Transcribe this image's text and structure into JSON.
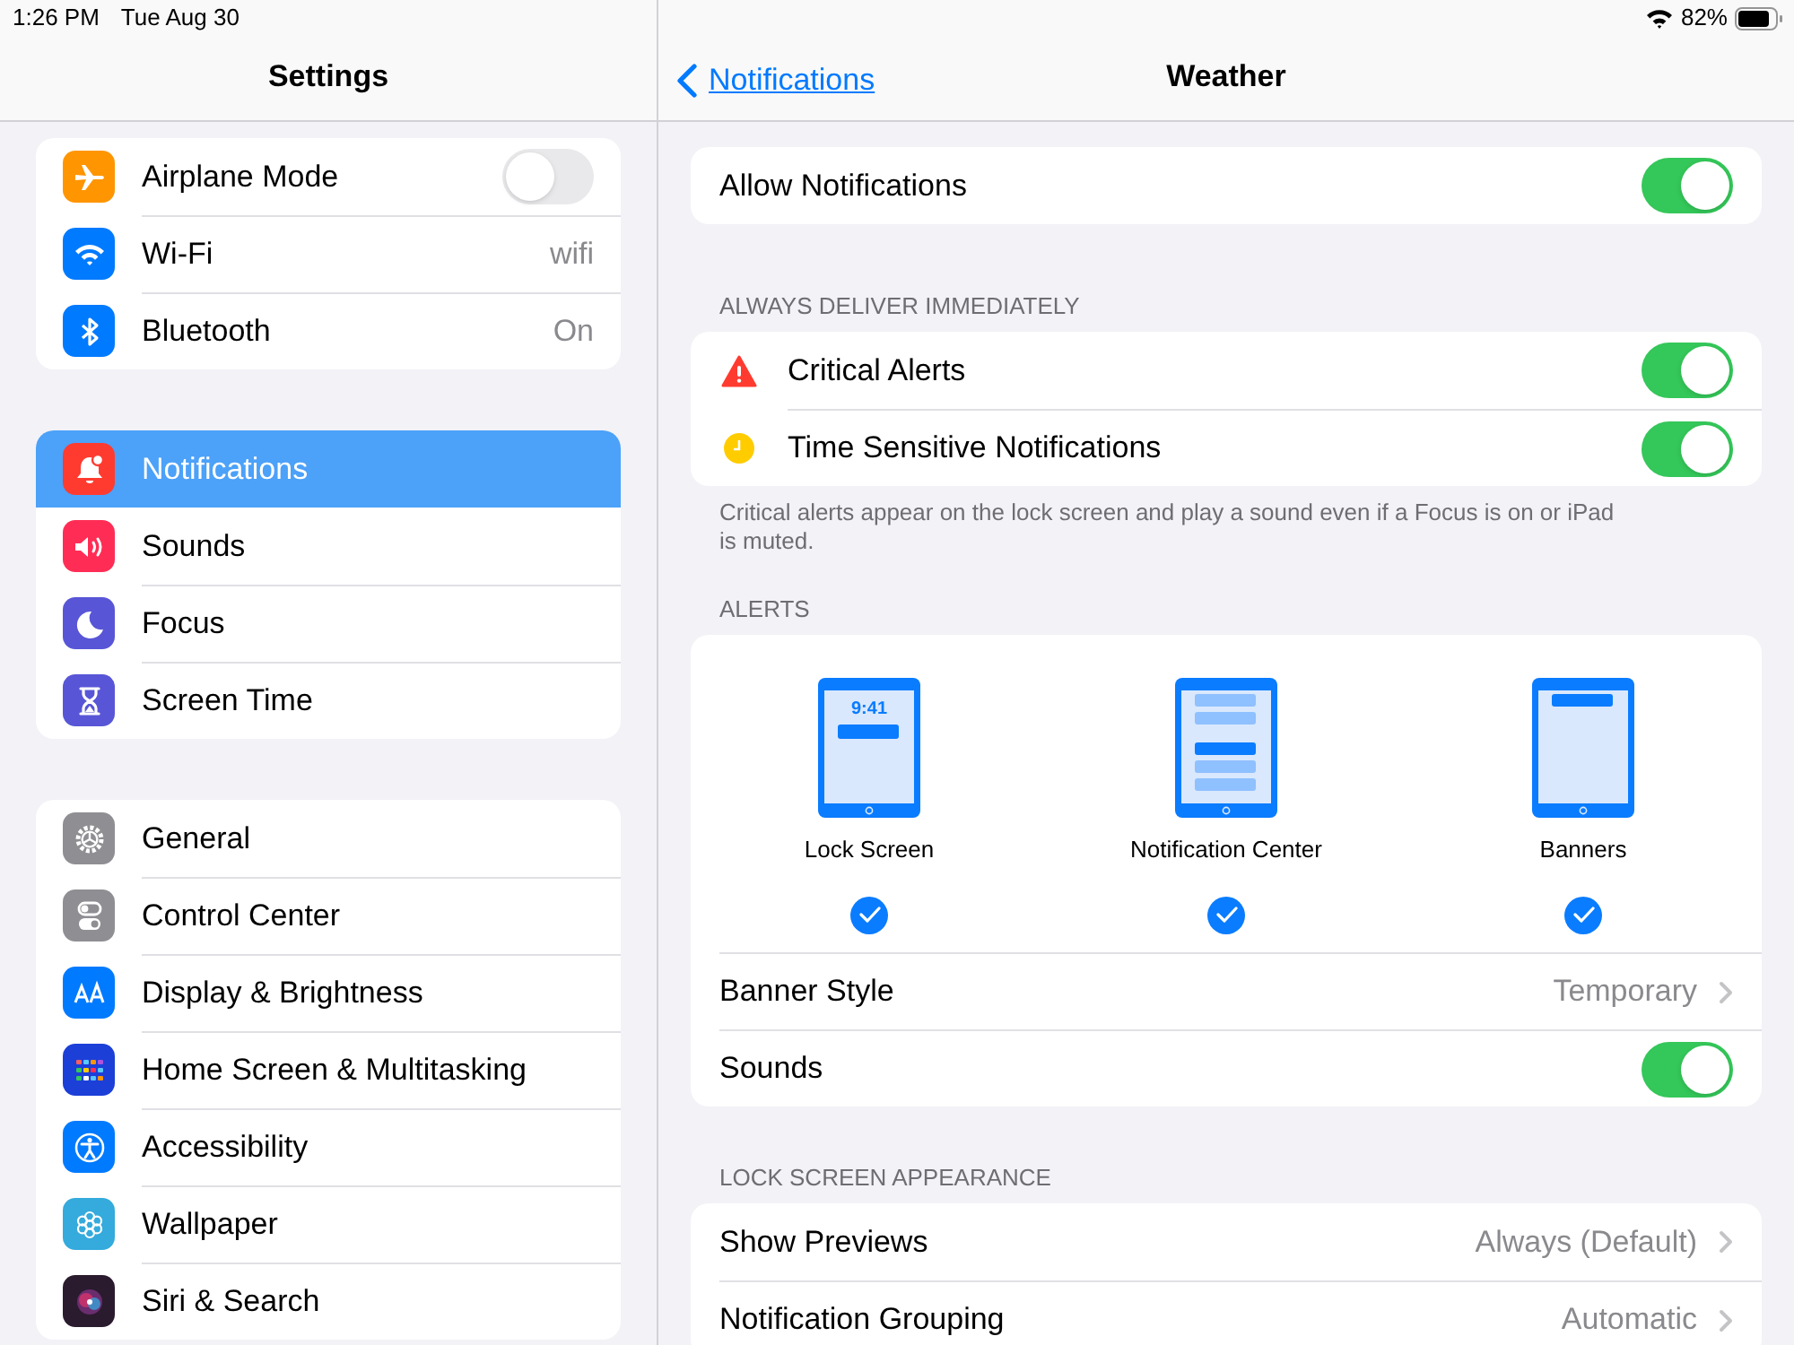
{
  "status_bar": {
    "time": "1:26 PM",
    "date": "Tue Aug 30",
    "battery": "82%"
  },
  "sidebar": {
    "title": "Settings",
    "groups": [
      {
        "items": [
          {
            "kind": "toggle",
            "label": "Airplane Mode",
            "on": false,
            "selected": false,
            "color": "#ff9500"
          },
          {
            "kind": "value",
            "label": "Wi-Fi",
            "value": "wifi",
            "selected": false,
            "color": "#007aff"
          },
          {
            "kind": "value",
            "label": "Bluetooth",
            "value": "On",
            "selected": false,
            "color": "#007aff"
          }
        ]
      },
      {
        "items": [
          {
            "kind": "link",
            "label": "Notifications",
            "selected": true,
            "color": "#ff3b30"
          },
          {
            "kind": "link",
            "label": "Sounds",
            "selected": false,
            "color": "#ff2d55"
          },
          {
            "kind": "link",
            "label": "Focus",
            "selected": false,
            "color": "#5856d6"
          },
          {
            "kind": "link",
            "label": "Screen Time",
            "selected": false,
            "color": "#5856d6"
          }
        ]
      },
      {
        "items": [
          {
            "kind": "link",
            "label": "General",
            "selected": false,
            "color": "#8e8e93"
          },
          {
            "kind": "link",
            "label": "Control Center",
            "selected": false,
            "color": "#8e8e93"
          },
          {
            "kind": "link",
            "label": "Display & Brightness",
            "selected": false,
            "color": "#007aff"
          },
          {
            "kind": "link",
            "label": "Home Screen & Multitasking",
            "selected": false,
            "color": "#1c3fd8"
          },
          {
            "kind": "link",
            "label": "Accessibility",
            "selected": false,
            "color": "#007aff"
          },
          {
            "kind": "link",
            "label": "Wallpaper",
            "selected": false,
            "color": "#35aadc"
          },
          {
            "kind": "link",
            "label": "Siri & Search",
            "selected": false,
            "color": "#2a1b2e"
          }
        ]
      }
    ]
  },
  "detail": {
    "back": "Notifications",
    "title": "Weather",
    "sections": [
      {
        "rows": [
          {
            "kind": "toggle",
            "label": "Allow Notifications",
            "on": true
          }
        ]
      },
      {
        "header": "ALWAYS DELIVER IMMEDIATELY",
        "rows": [
          {
            "kind": "toggle",
            "label": "Critical Alerts",
            "on": true
          },
          {
            "kind": "toggle",
            "label": "Time Sensitive Notifications",
            "on": true
          }
        ],
        "footer": "Critical alerts appear on the lock screen and play a sound even if a Focus is on or iPad is muted."
      },
      {
        "header": "ALERTS",
        "alert_styles": [
          {
            "kind": "lock_screen",
            "preview_time": "9:41",
            "label": "Lock Screen",
            "checked": true
          },
          {
            "kind": "notification_center",
            "label": "Notification Center",
            "checked": true
          },
          {
            "kind": "banners",
            "label": "Banners",
            "checked": true
          }
        ],
        "rows": [
          {
            "kind": "value",
            "label": "Banner Style",
            "value": "Temporary"
          },
          {
            "kind": "toggle",
            "label": "Sounds",
            "on": true
          }
        ]
      },
      {
        "header": "LOCK SCREEN APPEARANCE",
        "rows": [
          {
            "kind": "value",
            "label": "Show Previews",
            "value": "Always (Default)"
          },
          {
            "kind": "value",
            "label": "Notification Grouping",
            "value": "Automatic"
          }
        ]
      }
    ]
  }
}
